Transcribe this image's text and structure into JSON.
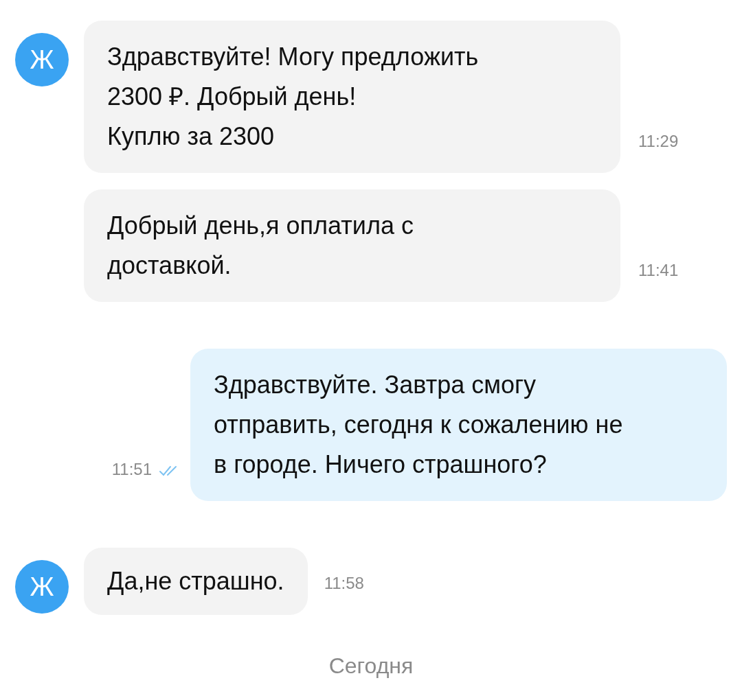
{
  "messages": [
    {
      "kind": "incoming",
      "avatar": "Ж",
      "lines": [
        "Здравствуйте! Могу предложить",
        "2300 ₽. Добрый день!",
        "Куплю за 2300"
      ],
      "time": "11:29"
    },
    {
      "kind": "incoming",
      "lines": [
        "Добрый день,я оплатила с",
        "доставкой."
      ],
      "time": "11:41"
    },
    {
      "kind": "outgoing",
      "lines": [
        "Здравствуйте. Завтра смогу",
        "отправить, сегодня к сожалению не",
        "в городе. Ничего страшного?"
      ],
      "time": "11:51",
      "read": true
    },
    {
      "kind": "incoming",
      "avatar": "Ж",
      "lines": [
        "Да,не страшно."
      ],
      "time": "11:58"
    }
  ],
  "date_separator": "Сегодня"
}
